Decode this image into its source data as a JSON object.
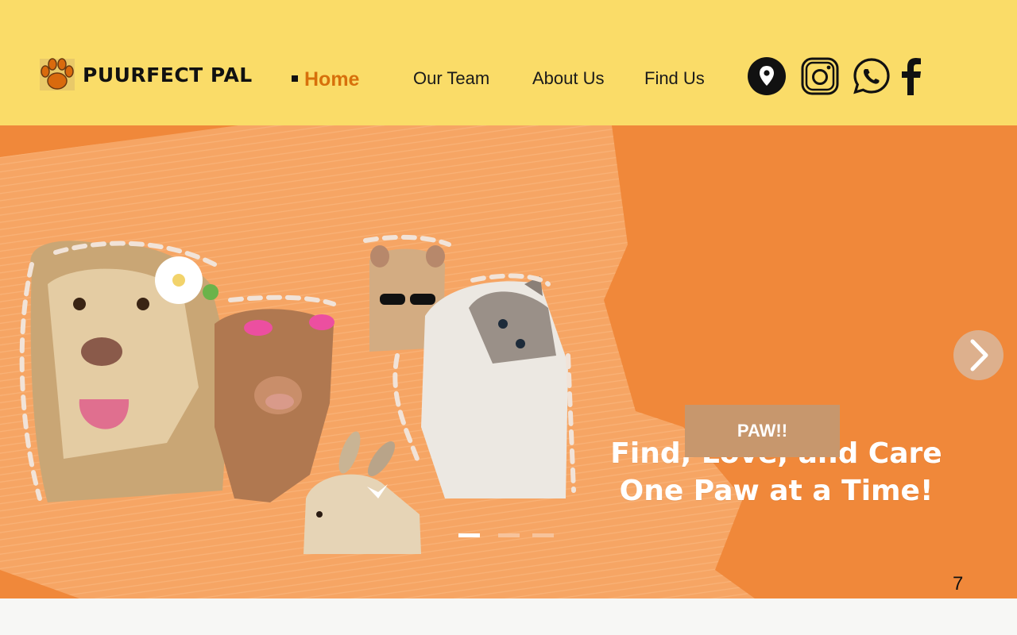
{
  "brand": {
    "name": "PUURFECT PAL",
    "logo_icon": "paw-icon",
    "accent": "#d7700b"
  },
  "nav": {
    "items": [
      {
        "label": "Home",
        "active": true
      },
      {
        "label": "Our Team",
        "active": false
      },
      {
        "label": "About Us",
        "active": false
      },
      {
        "label": "Find Us",
        "active": false
      }
    ]
  },
  "social": [
    "location-pin-icon",
    "instagram-icon",
    "whatsapp-icon",
    "facebook-icon"
  ],
  "hero": {
    "headline_line1": "Find, Love, and Care",
    "headline_line2": "One Paw at a Time!",
    "cta_label": "PAW!!",
    "animals": [
      "dog",
      "calf",
      "hamster",
      "cat",
      "rabbit"
    ],
    "slides": {
      "count": 3,
      "active": 1
    }
  },
  "page_number": "7",
  "colors": {
    "header_bg": "#fadc68",
    "hero_bg": "#f0883a",
    "cta_bg": "#c7976d"
  }
}
